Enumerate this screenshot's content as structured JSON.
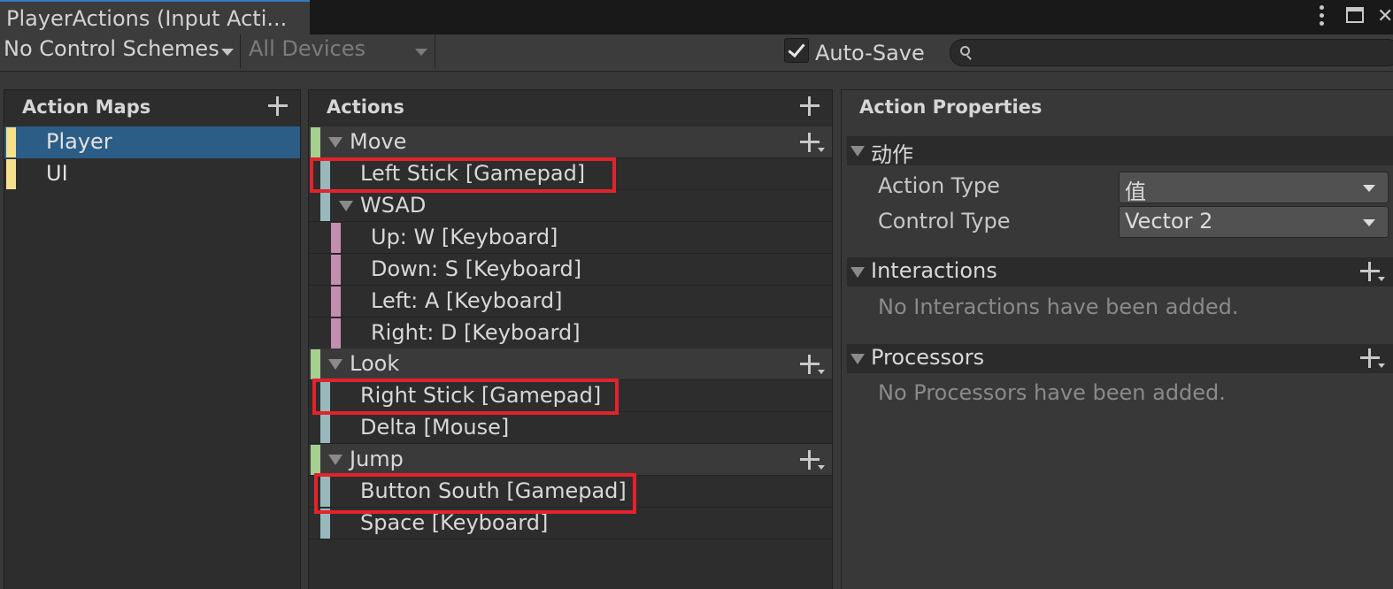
{
  "window": {
    "tab_title": "PlayerActions (Input Acti...",
    "icons": [
      "more-menu-icon",
      "maximize-icon",
      "close-icon"
    ]
  },
  "toolbar": {
    "control_schemes": "No Control Schemes",
    "devices": "All Devices",
    "autosave_label": "Auto-Save",
    "autosave_checked": true,
    "search_value": ""
  },
  "action_maps": {
    "header": "Action Maps",
    "items": [
      {
        "label": "Player",
        "selected": true
      },
      {
        "label": "UI",
        "selected": false
      }
    ]
  },
  "actions": {
    "header": "Actions",
    "tree": [
      {
        "type": "action",
        "label": "Move"
      },
      {
        "type": "binding",
        "label": "Left Stick [Gamepad]",
        "highlighted": true
      },
      {
        "type": "composite",
        "label": "WSAD"
      },
      {
        "type": "part",
        "label": "Up: W [Keyboard]"
      },
      {
        "type": "part",
        "label": "Down: S [Keyboard]"
      },
      {
        "type": "part",
        "label": "Left: A [Keyboard]"
      },
      {
        "type": "part",
        "label": "Right: D [Keyboard]"
      },
      {
        "type": "action",
        "label": "Look"
      },
      {
        "type": "binding",
        "label": "Right Stick [Gamepad]",
        "highlighted": true
      },
      {
        "type": "binding",
        "label": "Delta [Mouse]"
      },
      {
        "type": "action",
        "label": "Jump"
      },
      {
        "type": "binding",
        "label": "Button South [Gamepad]",
        "highlighted": true
      },
      {
        "type": "binding",
        "label": "Space [Keyboard]"
      }
    ],
    "highlight_color": "#e2232c"
  },
  "properties": {
    "header": "Action Properties",
    "action_section": "动作",
    "action_type_label": "Action Type",
    "action_type_value": "值",
    "control_type_label": "Control Type",
    "control_type_value": "Vector 2",
    "interactions_section": "Interactions",
    "interactions_empty": "No Interactions have been added.",
    "processors_section": "Processors",
    "processors_empty": "No Processors have been added."
  },
  "colors": {
    "selection": "#2c5d87",
    "map_marker": "#f5e08c",
    "action_marker": "#a4d090",
    "binding_marker": "#98b8bc",
    "part_marker": "#c48eae"
  }
}
